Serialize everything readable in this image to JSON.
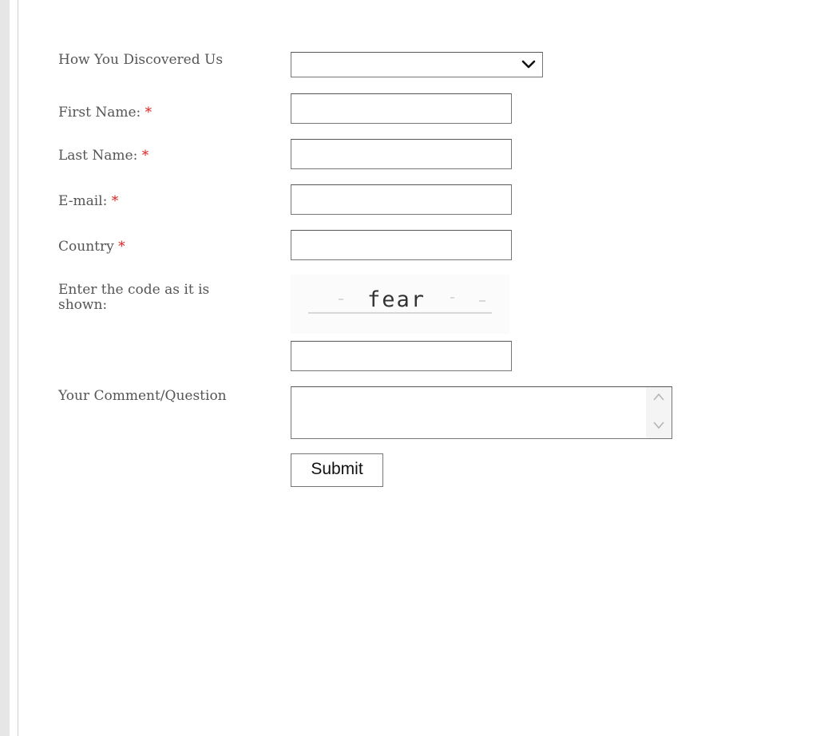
{
  "form": {
    "fields": {
      "discovered": {
        "label": "How You Discovered Us",
        "value": ""
      },
      "first_name": {
        "label": "First Name:",
        "required_mark": "*",
        "value": ""
      },
      "last_name": {
        "label": "Last Name:",
        "required_mark": "*",
        "value": ""
      },
      "email": {
        "label": "E-mail:",
        "required_mark": "*",
        "value": ""
      },
      "country": {
        "label": "Country",
        "required_mark": "*",
        "value": ""
      },
      "captcha": {
        "label": "Enter the code as it is shown:",
        "code": "fear",
        "value": ""
      },
      "comment": {
        "label": "Your Comment/Question",
        "value": ""
      }
    },
    "submit_label": "Submit"
  },
  "icons": {
    "select_arrow": "chevron-down-icon",
    "scroll_up": "chevron-up-icon",
    "scroll_down": "chevron-down-icon"
  },
  "colors": {
    "required": "#e02020",
    "label_text": "#555555",
    "border": "#767676"
  }
}
